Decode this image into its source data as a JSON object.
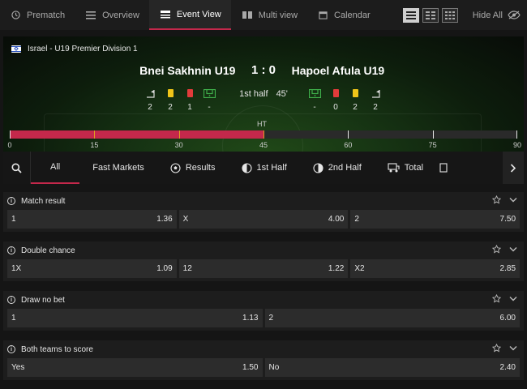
{
  "nav": {
    "tabs": [
      {
        "label": "Prematch"
      },
      {
        "label": "Overview"
      },
      {
        "label": "Event View"
      },
      {
        "label": "Multi view"
      },
      {
        "label": "Calendar"
      }
    ],
    "hide_all": "Hide All",
    "accent": "#c4284b"
  },
  "event": {
    "league": "Israel - U19 Premier Division 1",
    "home": "Bnei Sakhnin U19",
    "away": "Hapoel Afula U19",
    "score": "1 : 0",
    "period": "1st half",
    "minute": "45'",
    "home_stats": {
      "corners": "2",
      "yellow": "2",
      "red": "1",
      "penalties": "-"
    },
    "away_stats": {
      "penalties": "-",
      "red": "0",
      "yellow": "2",
      "corners": "2"
    },
    "ht_label": "HT",
    "timeline": {
      "progress_minutes": 45,
      "max_minutes": 90,
      "tick_labels": [
        "0",
        "15",
        "30",
        "45",
        "60",
        "75",
        "90"
      ]
    }
  },
  "filters": {
    "tabs": [
      {
        "label": "All"
      },
      {
        "label": "Fast Markets"
      },
      {
        "label": "Results"
      },
      {
        "label": "1st Half"
      },
      {
        "label": "2nd Half"
      },
      {
        "label": "Total"
      }
    ]
  },
  "markets": [
    {
      "title": "Match result",
      "odds": [
        {
          "label": "1",
          "value": "1.36"
        },
        {
          "label": "X",
          "value": "4.00"
        },
        {
          "label": "2",
          "value": "7.50"
        }
      ]
    },
    {
      "title": "Double chance",
      "odds": [
        {
          "label": "1X",
          "value": "1.09"
        },
        {
          "label": "12",
          "value": "1.22"
        },
        {
          "label": "X2",
          "value": "2.85"
        }
      ]
    },
    {
      "title": "Draw no bet",
      "odds": [
        {
          "label": "1",
          "value": "1.13"
        },
        {
          "label": "2",
          "value": "6.00"
        }
      ]
    },
    {
      "title": "Both teams to score",
      "odds": [
        {
          "label": "Yes",
          "value": "1.50"
        },
        {
          "label": "No",
          "value": "2.40"
        }
      ]
    }
  ]
}
